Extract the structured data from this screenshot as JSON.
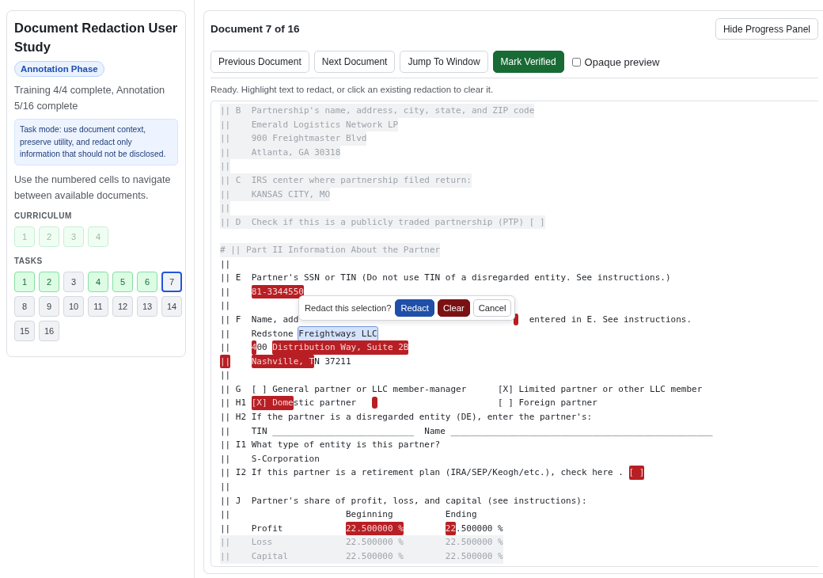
{
  "sidebar": {
    "title": "Document Redaction User Study",
    "phase_badge": "Annotation Phase",
    "progress": "Training 4/4 complete, Annotation 5/16 complete",
    "task_note": "Task mode: use document context, preserve utility, and redact only information that should not be disclosed.",
    "help": "Use the numbered cells to navigate between available documents.",
    "sections": [
      {
        "label": "CURRICULUM",
        "cells": [
          {
            "label": "1",
            "completed": true,
            "disabled": true,
            "selected": false
          },
          {
            "label": "2",
            "completed": true,
            "disabled": true,
            "selected": false
          },
          {
            "label": "3",
            "completed": true,
            "disabled": true,
            "selected": false
          },
          {
            "label": "4",
            "completed": true,
            "disabled": true,
            "selected": false
          }
        ]
      },
      {
        "label": "TASKS",
        "cells": [
          {
            "label": "1",
            "completed": true,
            "disabled": false,
            "selected": false
          },
          {
            "label": "2",
            "completed": true,
            "disabled": false,
            "selected": false
          },
          {
            "label": "3",
            "completed": false,
            "disabled": false,
            "selected": false
          },
          {
            "label": "4",
            "completed": true,
            "disabled": false,
            "selected": false
          },
          {
            "label": "5",
            "completed": true,
            "disabled": false,
            "selected": false
          },
          {
            "label": "6",
            "completed": true,
            "disabled": false,
            "selected": false
          },
          {
            "label": "7",
            "completed": false,
            "disabled": false,
            "selected": true
          },
          {
            "label": "8",
            "completed": false,
            "disabled": false,
            "selected": false
          },
          {
            "label": "9",
            "completed": false,
            "disabled": false,
            "selected": false
          },
          {
            "label": "10",
            "completed": false,
            "disabled": false,
            "selected": false
          },
          {
            "label": "11",
            "completed": false,
            "disabled": false,
            "selected": false
          },
          {
            "label": "12",
            "completed": false,
            "disabled": false,
            "selected": false
          },
          {
            "label": "13",
            "completed": false,
            "disabled": false,
            "selected": false
          },
          {
            "label": "14",
            "completed": false,
            "disabled": false,
            "selected": false
          },
          {
            "label": "15",
            "completed": false,
            "disabled": false,
            "selected": false
          },
          {
            "label": "16",
            "completed": false,
            "disabled": false,
            "selected": false
          }
        ]
      }
    ]
  },
  "header": {
    "title": "Document 7 of 16",
    "toggle_button": "Hide Progress Panel"
  },
  "toolbar": {
    "buttons": [
      {
        "label": "Previous Document",
        "kind": "default"
      },
      {
        "label": "Next Document",
        "kind": "default"
      },
      {
        "label": "Jump To Window",
        "kind": "default"
      },
      {
        "label": "Mark Verified",
        "kind": "primary"
      }
    ],
    "opaque_preview": {
      "label": "Opaque preview",
      "checked": false
    }
  },
  "status": "Ready. Highlight text to redact, or click an existing redaction to clear it.",
  "popup": {
    "question": "Redact this selection?",
    "buttons": [
      {
        "label": "Redact",
        "kind": "confirm"
      },
      {
        "label": "Clear",
        "kind": "danger"
      },
      {
        "label": "Cancel",
        "kind": "default"
      }
    ]
  },
  "document": {
    "lines": [
      {
        "muted": true,
        "segments": [
          {
            "kind": "plain",
            "text": "|| B  Partnership's name, address, city, state, and ZIP code"
          }
        ]
      },
      {
        "muted": true,
        "segments": [
          {
            "kind": "plain",
            "text": "||    Emerald Logistics Network LP"
          }
        ]
      },
      {
        "muted": true,
        "segments": [
          {
            "kind": "plain",
            "text": "||    900 Freightmaster Blvd"
          }
        ]
      },
      {
        "muted": true,
        "segments": [
          {
            "kind": "plain",
            "text": "||    Atlanta, GA 30318"
          }
        ]
      },
      {
        "muted": true,
        "segments": [
          {
            "kind": "plain",
            "text": "||"
          }
        ]
      },
      {
        "muted": true,
        "segments": [
          {
            "kind": "plain",
            "text": "|| C  IRS center where partnership filed return:"
          }
        ]
      },
      {
        "muted": true,
        "segments": [
          {
            "kind": "plain",
            "text": "||    KANSAS CITY, MO"
          }
        ]
      },
      {
        "muted": true,
        "segments": [
          {
            "kind": "plain",
            "text": "||"
          }
        ]
      },
      {
        "muted": true,
        "segments": [
          {
            "kind": "plain",
            "text": "|| D  Check if this is a publicly traded partnership (PTP) [ ]"
          }
        ]
      },
      {
        "muted": true,
        "spaced": true,
        "segments": [
          {
            "kind": "plain",
            "text": "# || Part II Information About the Partner"
          }
        ]
      },
      {
        "muted": false,
        "segments": [
          {
            "kind": "plain",
            "text": "||"
          }
        ]
      },
      {
        "muted": false,
        "segments": [
          {
            "kind": "plain",
            "text": "|| E  Partner's SSN or TIN (Do not use TIN of a disregarded entity. See instructions.)"
          }
        ]
      },
      {
        "muted": false,
        "segments": [
          {
            "kind": "plain",
            "text": "||    "
          },
          {
            "kind": "redacted",
            "text": "81-3344550"
          }
        ]
      },
      {
        "muted": false,
        "segments": [
          {
            "kind": "plain",
            "text": "||"
          }
        ]
      },
      {
        "muted": false,
        "segments": [
          {
            "kind": "plain",
            "text": "|| F  Name, add"
          },
          {
            "kind": "covered"
          },
          {
            "kind": "stub"
          },
          {
            "kind": "plain",
            "text": "  entered in E. See instructions."
          }
        ]
      },
      {
        "muted": false,
        "segments": [
          {
            "kind": "plain",
            "text": "||    Redstone "
          },
          {
            "kind": "selected",
            "text": "Freightways LLC"
          }
        ]
      },
      {
        "muted": false,
        "segments": [
          {
            "kind": "plain",
            "text": "||    "
          },
          {
            "kind": "redacted",
            "text": "4"
          },
          {
            "kind": "plain",
            "text": "00 "
          },
          {
            "kind": "redacted",
            "text": "Distribution Way, Suite 2B"
          }
        ]
      },
      {
        "muted": false,
        "segments": [
          {
            "kind": "redacted",
            "text": "||"
          },
          {
            "kind": "tab"
          },
          {
            "kind": "redacted",
            "text": "Nashville, T"
          },
          {
            "kind": "plain",
            "text": "N 37211"
          }
        ]
      },
      {
        "muted": false,
        "segments": [
          {
            "kind": "plain",
            "text": "||"
          }
        ]
      },
      {
        "muted": false,
        "segments": [
          {
            "kind": "plain",
            "text": "|| G  [ ] General partner or LLC member-manager      [X] Limited partner or other LLC member"
          }
        ]
      },
      {
        "muted": false,
        "segments": [
          {
            "kind": "plain",
            "text": "|| H1 "
          },
          {
            "kind": "redacted",
            "text": "[X] Dome"
          },
          {
            "kind": "plain",
            "text": "stic partner   "
          },
          {
            "kind": "stub"
          },
          {
            "kind": "plain",
            "text": "                       [ ] Foreign partner"
          }
        ]
      },
      {
        "muted": false,
        "segments": [
          {
            "kind": "plain",
            "text": "|| H2 If the partner is a disregarded entity (DE), enter the partner's:"
          }
        ]
      },
      {
        "muted": false,
        "segments": [
          {
            "kind": "plain",
            "text": "||    TIN ___________________________  Name __________________________________________________"
          }
        ]
      },
      {
        "muted": false,
        "segments": [
          {
            "kind": "plain",
            "text": "|| I1 What type of entity is this partner?"
          }
        ]
      },
      {
        "muted": false,
        "segments": [
          {
            "kind": "plain",
            "text": "||    S-Corporation"
          }
        ]
      },
      {
        "muted": false,
        "segments": [
          {
            "kind": "plain",
            "text": "|| I2 If this partner is a retirement plan (IRA/SEP/Keogh/etc.), check here . "
          },
          {
            "kind": "redacted",
            "text": "[ ]"
          }
        ]
      },
      {
        "muted": false,
        "segments": [
          {
            "kind": "plain",
            "text": "||"
          }
        ]
      },
      {
        "muted": false,
        "segments": [
          {
            "kind": "plain",
            "text": "|| J  Partner's share of profit, loss, and capital (see instructions):"
          }
        ]
      },
      {
        "muted": false,
        "segments": [
          {
            "kind": "plain",
            "text": "||                      Beginning          Ending"
          }
        ]
      },
      {
        "muted": false,
        "segments": [
          {
            "kind": "plain",
            "text": "||    Profit            "
          },
          {
            "kind": "redacted",
            "text": "22.500000 %"
          },
          {
            "kind": "tab"
          },
          {
            "kind": "tab"
          },
          {
            "kind": "redacted",
            "text": "22"
          },
          {
            "kind": "plain",
            "text": ".500000 %"
          }
        ]
      },
      {
        "muted": true,
        "segments": [
          {
            "kind": "plain",
            "text": "||    Loss              22.500000 %        22.500000 %"
          }
        ]
      },
      {
        "muted": true,
        "segments": [
          {
            "kind": "plain",
            "text": "||    Capital           22.500000 %        22.500000 %"
          }
        ]
      }
    ]
  }
}
